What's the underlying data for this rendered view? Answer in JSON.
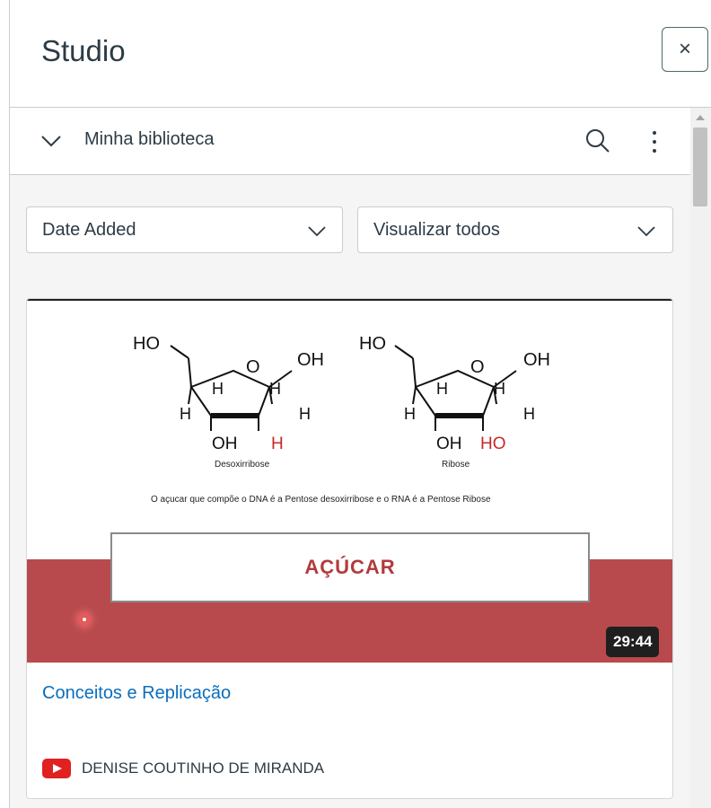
{
  "app": {
    "title": "Studio",
    "close_label": "×"
  },
  "library": {
    "label": "Minha biblioteca"
  },
  "filters": {
    "sort_value": "Date Added",
    "view_value": "Visualizar todos"
  },
  "video": {
    "thumbnail": {
      "molecule_left": {
        "name": "Desoxirribose",
        "ho": "HO",
        "oh": "OH",
        "o": "O",
        "h": "H",
        "bottom_oh": "OH",
        "bottom_h": "H"
      },
      "molecule_right": {
        "name": "Ribose",
        "ho": "HO",
        "oh": "OH",
        "o": "O",
        "h": "H",
        "bottom_oh": "OH",
        "bottom_ho": "HO"
      },
      "description": "O açucar que compõe o DNA é a Pentose desoxirribose e o RNA é a Pentose Ribose",
      "banner_text": "AÇÚCAR"
    },
    "duration": "29:44",
    "title": "Conceitos e Replicação",
    "owner": "DENISE COUTINHO DE MIRANDA",
    "source_icon": "youtube-icon"
  },
  "colors": {
    "accent_link": "#0a6ebd",
    "banner": "#b84a4d",
    "banner_text": "#b23a3e",
    "youtube": "#e0211f"
  }
}
